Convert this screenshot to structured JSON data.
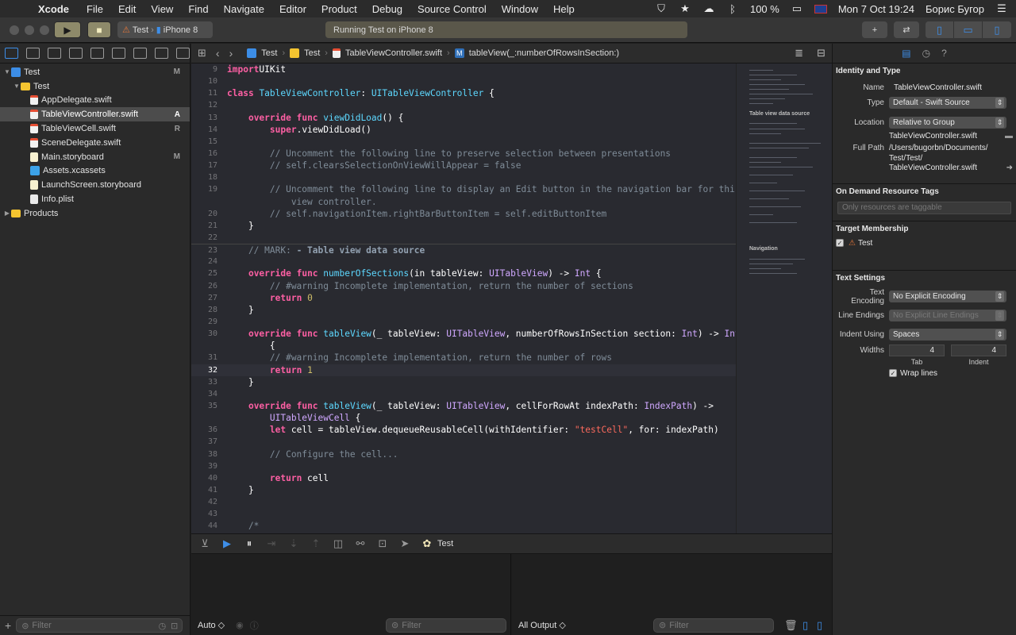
{
  "menubar": {
    "app_name": "Xcode",
    "items": [
      "File",
      "Edit",
      "View",
      "Find",
      "Navigate",
      "Editor",
      "Product",
      "Debug",
      "Source Control",
      "Window",
      "Help"
    ],
    "battery": "100 %",
    "clock": "Mon 7 Oct  19:24",
    "user": "Борис Бугор"
  },
  "toolbar": {
    "scheme": "Test",
    "device": "iPhone 8",
    "activity_status": "Running Test on iPhone 8",
    "accent_color": "#3e8ee8"
  },
  "navigator": {
    "tree": [
      {
        "label": "Test",
        "icon": "project",
        "indent": 0,
        "disclosure": "▼",
        "status": "M"
      },
      {
        "label": "Test",
        "icon": "folder",
        "indent": 1,
        "disclosure": "▼",
        "status": ""
      },
      {
        "label": "AppDelegate.swift",
        "icon": "swift",
        "indent": 2,
        "disclosure": "",
        "status": ""
      },
      {
        "label": "TableViewController.swift",
        "icon": "swift",
        "indent": 2,
        "disclosure": "",
        "status": "A",
        "selected": true
      },
      {
        "label": "TableViewCell.swift",
        "icon": "swift",
        "indent": 2,
        "disclosure": "",
        "status": "R"
      },
      {
        "label": "SceneDelegate.swift",
        "icon": "swift",
        "indent": 2,
        "disclosure": "",
        "status": ""
      },
      {
        "label": "Main.storyboard",
        "icon": "storyboard",
        "indent": 2,
        "disclosure": "",
        "status": "M"
      },
      {
        "label": "Assets.xcassets",
        "icon": "assets",
        "indent": 2,
        "disclosure": "",
        "status": ""
      },
      {
        "label": "LaunchScreen.storyboard",
        "icon": "storyboard",
        "indent": 2,
        "disclosure": "",
        "status": ""
      },
      {
        "label": "Info.plist",
        "icon": "plist",
        "indent": 2,
        "disclosure": "",
        "status": ""
      },
      {
        "label": "Products",
        "icon": "folder",
        "indent": 0,
        "disclosure": "▶",
        "status": ""
      }
    ],
    "filter_placeholder": "Filter"
  },
  "editor": {
    "breadcrumb": [
      "Test",
      "Test",
      "TableViewController.swift",
      "tableView(_:numberOfRowsInSection:)"
    ],
    "current_line": "32",
    "lines": [
      {
        "n": "9",
        "tokens": [
          [
            "kw",
            "import"
          ],
          [
            "",
            "UIKit"
          ]
        ]
      },
      {
        "n": "10",
        "tokens": []
      },
      {
        "n": "11",
        "tokens": [
          [
            "kw",
            "class"
          ],
          [
            "",
            " "
          ],
          [
            "ty",
            "TableViewController"
          ],
          [
            "",
            ": "
          ],
          [
            "ty",
            "UITableViewController"
          ],
          [
            "",
            " {"
          ]
        ]
      },
      {
        "n": "12",
        "tokens": []
      },
      {
        "n": "13",
        "tokens": [
          [
            "",
            "    "
          ],
          [
            "kw",
            "override"
          ],
          [
            "",
            " "
          ],
          [
            "kw",
            "func"
          ],
          [
            "",
            " "
          ],
          [
            "ty",
            "viewDidLoad"
          ],
          [
            "",
            "() {"
          ]
        ]
      },
      {
        "n": "14",
        "tokens": [
          [
            "",
            "        "
          ],
          [
            "kw",
            "super"
          ],
          [
            "",
            ".viewDidLoad()"
          ]
        ]
      },
      {
        "n": "15",
        "tokens": []
      },
      {
        "n": "16",
        "tokens": [
          [
            "cm",
            "        // Uncomment the following line to preserve selection between presentations"
          ]
        ]
      },
      {
        "n": "17",
        "tokens": [
          [
            "cm",
            "        // self.clearsSelectionOnViewWillAppear = false"
          ]
        ]
      },
      {
        "n": "18",
        "tokens": []
      },
      {
        "n": "19",
        "tokens": [
          [
            "cm",
            "        // Uncomment the following line to display an Edit button in the navigation bar for this"
          ]
        ]
      },
      {
        "n": "",
        "tokens": [
          [
            "cm",
            "            view controller."
          ]
        ]
      },
      {
        "n": "20",
        "tokens": [
          [
            "cm",
            "        // self.navigationItem.rightBarButtonItem = self.editButtonItem"
          ]
        ]
      },
      {
        "n": "21",
        "tokens": [
          [
            "",
            "    }"
          ]
        ]
      },
      {
        "n": "22",
        "tokens": []
      },
      {
        "n": "23",
        "tokens": [
          [
            "cm",
            "    // MARK: "
          ],
          [
            "mark",
            "- Table view data source"
          ]
        ],
        "sep": true
      },
      {
        "n": "24",
        "tokens": []
      },
      {
        "n": "25",
        "tokens": [
          [
            "",
            "    "
          ],
          [
            "kw",
            "override"
          ],
          [
            "",
            " "
          ],
          [
            "kw",
            "func"
          ],
          [
            "",
            " "
          ],
          [
            "ty",
            "numberOfSections"
          ],
          [
            "",
            "(in tableView: "
          ],
          [
            "tyc",
            "UITableView"
          ],
          [
            "",
            ") -> "
          ],
          [
            "tyc",
            "Int"
          ],
          [
            "",
            " {"
          ]
        ]
      },
      {
        "n": "26",
        "tokens": [
          [
            "cm",
            "        // #warning Incomplete implementation, return the number of sections"
          ]
        ]
      },
      {
        "n": "27",
        "tokens": [
          [
            "",
            "        "
          ],
          [
            "kw",
            "return"
          ],
          [
            "",
            " "
          ],
          [
            "num",
            "0"
          ]
        ]
      },
      {
        "n": "28",
        "tokens": [
          [
            "",
            "    }"
          ]
        ]
      },
      {
        "n": "29",
        "tokens": []
      },
      {
        "n": "30",
        "tokens": [
          [
            "",
            "    "
          ],
          [
            "kw",
            "override"
          ],
          [
            "",
            " "
          ],
          [
            "kw",
            "func"
          ],
          [
            "",
            " "
          ],
          [
            "ty",
            "tableView"
          ],
          [
            "",
            "(_ tableView: "
          ],
          [
            "tyc",
            "UITableView"
          ],
          [
            "",
            ", numberOfRowsInSection section: "
          ],
          [
            "tyc",
            "Int"
          ],
          [
            "",
            ") -> "
          ],
          [
            "tyc",
            "Int"
          ]
        ]
      },
      {
        "n": "",
        "tokens": [
          [
            "",
            "        {"
          ]
        ]
      },
      {
        "n": "31",
        "tokens": [
          [
            "cm",
            "        // #warning Incomplete implementation, return the number of rows"
          ]
        ]
      },
      {
        "n": "32",
        "tokens": [
          [
            "",
            "        "
          ],
          [
            "kw",
            "return"
          ],
          [
            "",
            " "
          ],
          [
            "num",
            "1"
          ]
        ],
        "current": true
      },
      {
        "n": "33",
        "tokens": [
          [
            "",
            "    }"
          ]
        ]
      },
      {
        "n": "34",
        "tokens": []
      },
      {
        "n": "35",
        "tokens": [
          [
            "",
            "    "
          ],
          [
            "kw",
            "override"
          ],
          [
            "",
            " "
          ],
          [
            "kw",
            "func"
          ],
          [
            "",
            " "
          ],
          [
            "ty",
            "tableView"
          ],
          [
            "",
            "(_ tableView: "
          ],
          [
            "tyc",
            "UITableView"
          ],
          [
            "",
            ", cellForRowAt indexPath: "
          ],
          [
            "tyc",
            "IndexPath"
          ],
          [
            "",
            ") ->"
          ]
        ]
      },
      {
        "n": "",
        "tokens": [
          [
            "",
            "        "
          ],
          [
            "tyc",
            "UITableViewCell"
          ],
          [
            "",
            " {"
          ]
        ]
      },
      {
        "n": "36",
        "tokens": [
          [
            "",
            "        "
          ],
          [
            "kw",
            "let"
          ],
          [
            "",
            " cell = tableView.dequeueReusableCell(withIdentifier: "
          ],
          [
            "str",
            "\"testCell\""
          ],
          [
            "",
            ", for: indexPath)"
          ]
        ]
      },
      {
        "n": "37",
        "tokens": []
      },
      {
        "n": "38",
        "tokens": [
          [
            "cm",
            "        // Configure the cell..."
          ]
        ]
      },
      {
        "n": "39",
        "tokens": []
      },
      {
        "n": "40",
        "tokens": [
          [
            "",
            "        "
          ],
          [
            "kw",
            "return"
          ],
          [
            "",
            " cell"
          ]
        ]
      },
      {
        "n": "41",
        "tokens": [
          [
            "",
            "    }"
          ]
        ]
      },
      {
        "n": "42",
        "tokens": []
      },
      {
        "n": "43",
        "tokens": []
      },
      {
        "n": "44",
        "tokens": [
          [
            "cm",
            "    /*"
          ]
        ]
      }
    ],
    "minimap_labels": [
      "Table view data source",
      "Navigation"
    ]
  },
  "debug": {
    "target": "Test",
    "variables_scope": "Auto ◇",
    "output_scope": "All Output ◇",
    "filter_placeholder": "Filter"
  },
  "inspector": {
    "identity_title": "Identity and Type",
    "name_label": "Name",
    "name_value": "TableViewController.swift",
    "type_label": "Type",
    "type_value": "Default - Swift Source",
    "location_label": "Location",
    "location_value": "Relative to Group",
    "location_file": "TableViewController.swift",
    "fullpath_label": "Full Path",
    "fullpath_value": [
      "/Users/bugorbn/Documents/",
      "Test/Test/",
      "TableViewController.swift"
    ],
    "odr_title": "On Demand Resource Tags",
    "odr_placeholder": "Only resources are taggable",
    "target_title": "Target Membership",
    "target_name": "Test",
    "text_title": "Text Settings",
    "encoding_label": "Text Encoding",
    "encoding_value": "No Explicit Encoding",
    "line_endings_label": "Line Endings",
    "line_endings_value": "No Explicit Line Endings",
    "indent_label": "Indent Using",
    "indent_value": "Spaces",
    "widths_label": "Widths",
    "tab_width": "4",
    "indent_width": "4",
    "tab_caption": "Tab",
    "indent_caption": "Indent",
    "wrap_label": "Wrap lines"
  }
}
